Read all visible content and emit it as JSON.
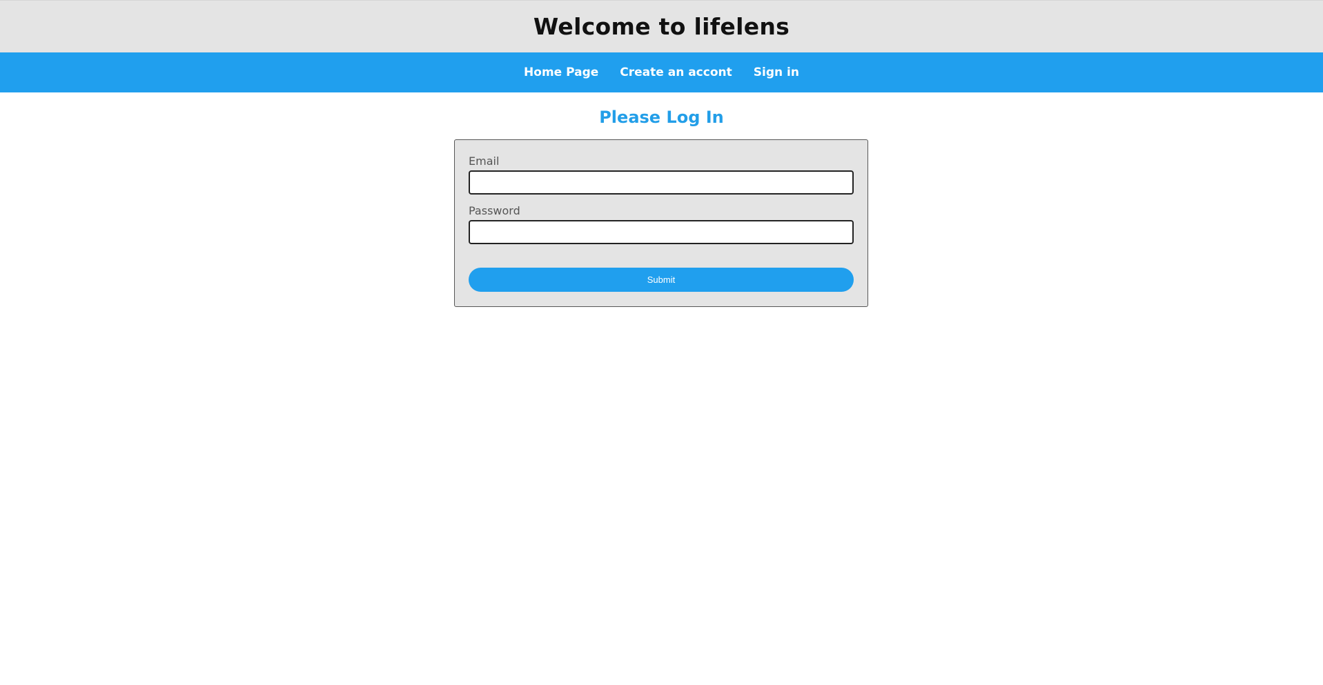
{
  "header": {
    "title": "Welcome to lifelens"
  },
  "nav": {
    "items": [
      {
        "label": "Home Page"
      },
      {
        "label": "Create an accont"
      },
      {
        "label": "Sign in"
      }
    ]
  },
  "main": {
    "heading": "Please Log In",
    "form": {
      "email_label": "Email",
      "email_value": "",
      "password_label": "Password",
      "password_value": "",
      "submit_label": "Submit"
    }
  },
  "colors": {
    "accent": "#209fee",
    "header_bg": "#e4e4e4",
    "card_bg": "#e4e4e4"
  }
}
